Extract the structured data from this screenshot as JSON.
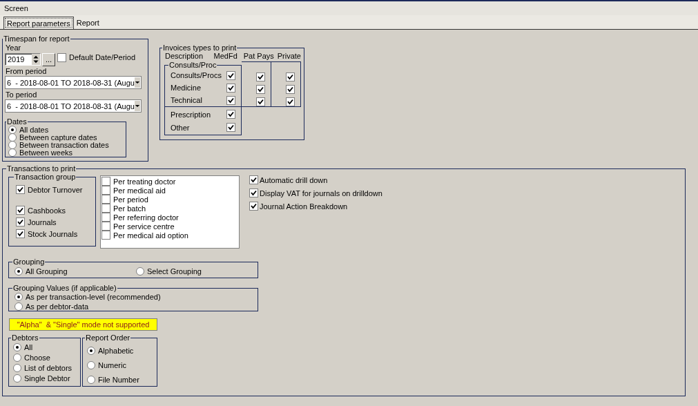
{
  "window": {
    "title": "Screen"
  },
  "tabs": [
    {
      "label": "Report parameters",
      "selected": true
    },
    {
      "label": "Report",
      "selected": false
    }
  ],
  "timespan": {
    "title": "Timespan for report",
    "year_label": "Year",
    "year": "2019",
    "browse_button": "...",
    "default_period": {
      "label": "Default Date/Period",
      "checked": false
    },
    "from_label": "From period",
    "from_value": "6  - 2018-08-01 TO 2018-08-31 (Augu",
    "to_label": "To period",
    "to_value": "6  - 2018-08-01 TO 2018-08-31 (Augu",
    "dates": {
      "title": "Dates",
      "options": [
        {
          "label": "All dates",
          "selected": true
        },
        {
          "label": "Between capture dates",
          "selected": false
        },
        {
          "label": "Between transaction dates",
          "selected": false
        },
        {
          "label": "Between weeks",
          "selected": false
        }
      ]
    }
  },
  "invoice_types": {
    "title": "Invoices types to print",
    "columns": [
      "Description",
      "MedFd",
      "Pat Pays",
      "Private"
    ],
    "group_title": "Consults/Proc",
    "rows": [
      {
        "label": "Consults/Procs",
        "checks": [
          true,
          true,
          true
        ]
      },
      {
        "label": "Medicine",
        "checks": [
          true,
          true,
          true
        ]
      },
      {
        "label": "Technical",
        "checks": [
          true,
          true,
          true
        ]
      }
    ],
    "extra_rows": [
      {
        "label": "Prescription",
        "checked": true
      },
      {
        "label": "Other",
        "checked": true
      }
    ]
  },
  "transactions": {
    "title": "Transactions to print",
    "group": {
      "title": "Transaction group",
      "items": [
        {
          "label": "Debtor Turnover",
          "checked": true
        },
        {
          "label": "Cashbooks",
          "checked": true
        },
        {
          "label": "Journals",
          "checked": true
        },
        {
          "label": "Stock Journals",
          "checked": true
        }
      ]
    },
    "breakdowns": [
      {
        "label": "Per treating doctor",
        "checked": false
      },
      {
        "label": "Per medical aid",
        "checked": false
      },
      {
        "label": "Per period",
        "checked": false
      },
      {
        "label": "Per batch",
        "checked": false
      },
      {
        "label": "Per referring doctor",
        "checked": false
      },
      {
        "label": "Per service centre",
        "checked": false
      },
      {
        "label": "Per medical aid option",
        "checked": false
      }
    ],
    "options": [
      {
        "label": "Automatic drill down",
        "checked": true
      },
      {
        "label": "Display VAT for journals on drilldown",
        "checked": true
      },
      {
        "label": "Journal Action Breakdown",
        "checked": true
      }
    ],
    "grouping": {
      "title": "Grouping",
      "options": [
        {
          "label": "All Grouping",
          "selected": true
        },
        {
          "label": "Select Grouping",
          "selected": false
        }
      ]
    },
    "grouping_values": {
      "title": "Grouping Values (if applicable)",
      "options": [
        {
          "label": "As per transaction-level (recommended)",
          "selected": true
        },
        {
          "label": "As per debtor-data",
          "selected": false
        }
      ]
    },
    "warning": "\"Alpha\"  & \"Single\" mode not supported",
    "debtors": {
      "title": "Debtors",
      "options": [
        {
          "label": "All",
          "selected": true
        },
        {
          "label": "Choose",
          "selected": false
        },
        {
          "label": "List of debtors",
          "selected": false
        },
        {
          "label": "Single Debtor",
          "selected": false
        }
      ]
    },
    "report_order": {
      "title": "Report Order",
      "options": [
        {
          "label": "Alphabetic",
          "selected": true
        },
        {
          "label": "Numeric",
          "selected": false
        },
        {
          "label": "File Number",
          "selected": false
        }
      ]
    }
  }
}
